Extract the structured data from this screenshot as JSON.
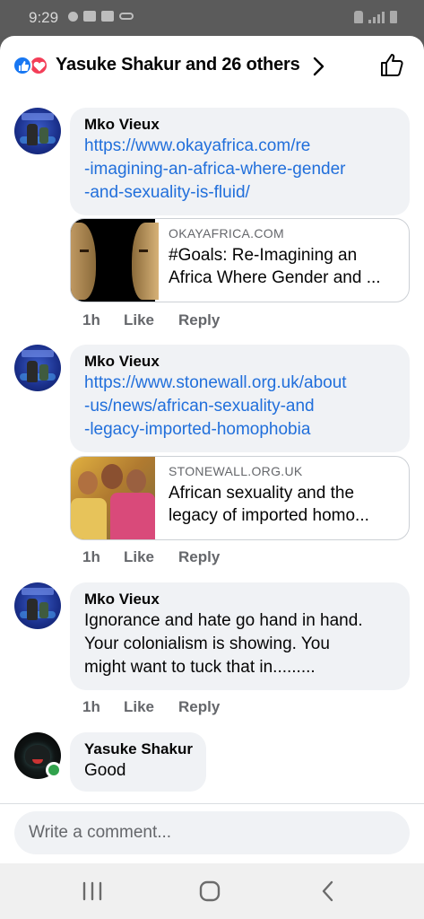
{
  "status_bar": {
    "time": "9:29"
  },
  "header": {
    "reactors_text": "Yasuke Shakur and 26 others"
  },
  "comments": [
    {
      "author": "Mko Vieux",
      "link": "https://www.okayafrica.com/re-imagining-an-africa-where-gender-and-sexuality-is-fluid/",
      "link_lines": [
        "https://www.okayafrica.com/re",
        "-imagining-an-africa-where-gender",
        "-and-sexuality-is-fluid/"
      ],
      "preview": {
        "domain": "OKAYAFRICA.COM",
        "title_lines": [
          "#Goals: Re-Imagining an",
          "Africa Where Gender and ..."
        ]
      },
      "time": "1h",
      "like_label": "Like",
      "reply_label": "Reply"
    },
    {
      "author": "Mko Vieux",
      "link": "https://www.stonewall.org.uk/about-us/news/african-sexuality-and-legacy-imported-homophobia",
      "link_lines": [
        "https://www.stonewall.org.uk/about",
        "-us/news/african-sexuality-and",
        "-legacy-imported-homophobia"
      ],
      "preview": {
        "domain": "STONEWALL.ORG.UK",
        "title_lines": [
          "African sexuality and the",
          "legacy of imported homo..."
        ]
      },
      "time": "1h",
      "like_label": "Like",
      "reply_label": "Reply"
    },
    {
      "author": "Mko Vieux",
      "text_lines": [
        "Ignorance and hate go hand in hand.",
        "Your colonialism is showing. You",
        "might want to tuck that in........."
      ],
      "time": "1h",
      "like_label": "Like",
      "reply_label": "Reply"
    },
    {
      "author": "Yasuke Shakur",
      "text": "Good",
      "online": true
    }
  ],
  "composer": {
    "placeholder": "Write a comment..."
  },
  "colors": {
    "link": "#216fdb",
    "like_reaction": "#1877f2",
    "love_reaction": "#f33e58",
    "online": "#31a24c"
  },
  "icons": [
    "like-reaction-icon",
    "love-reaction-icon",
    "chevron-right-icon",
    "thumbs-up-icon",
    "recents-icon",
    "home-icon",
    "back-icon"
  ]
}
